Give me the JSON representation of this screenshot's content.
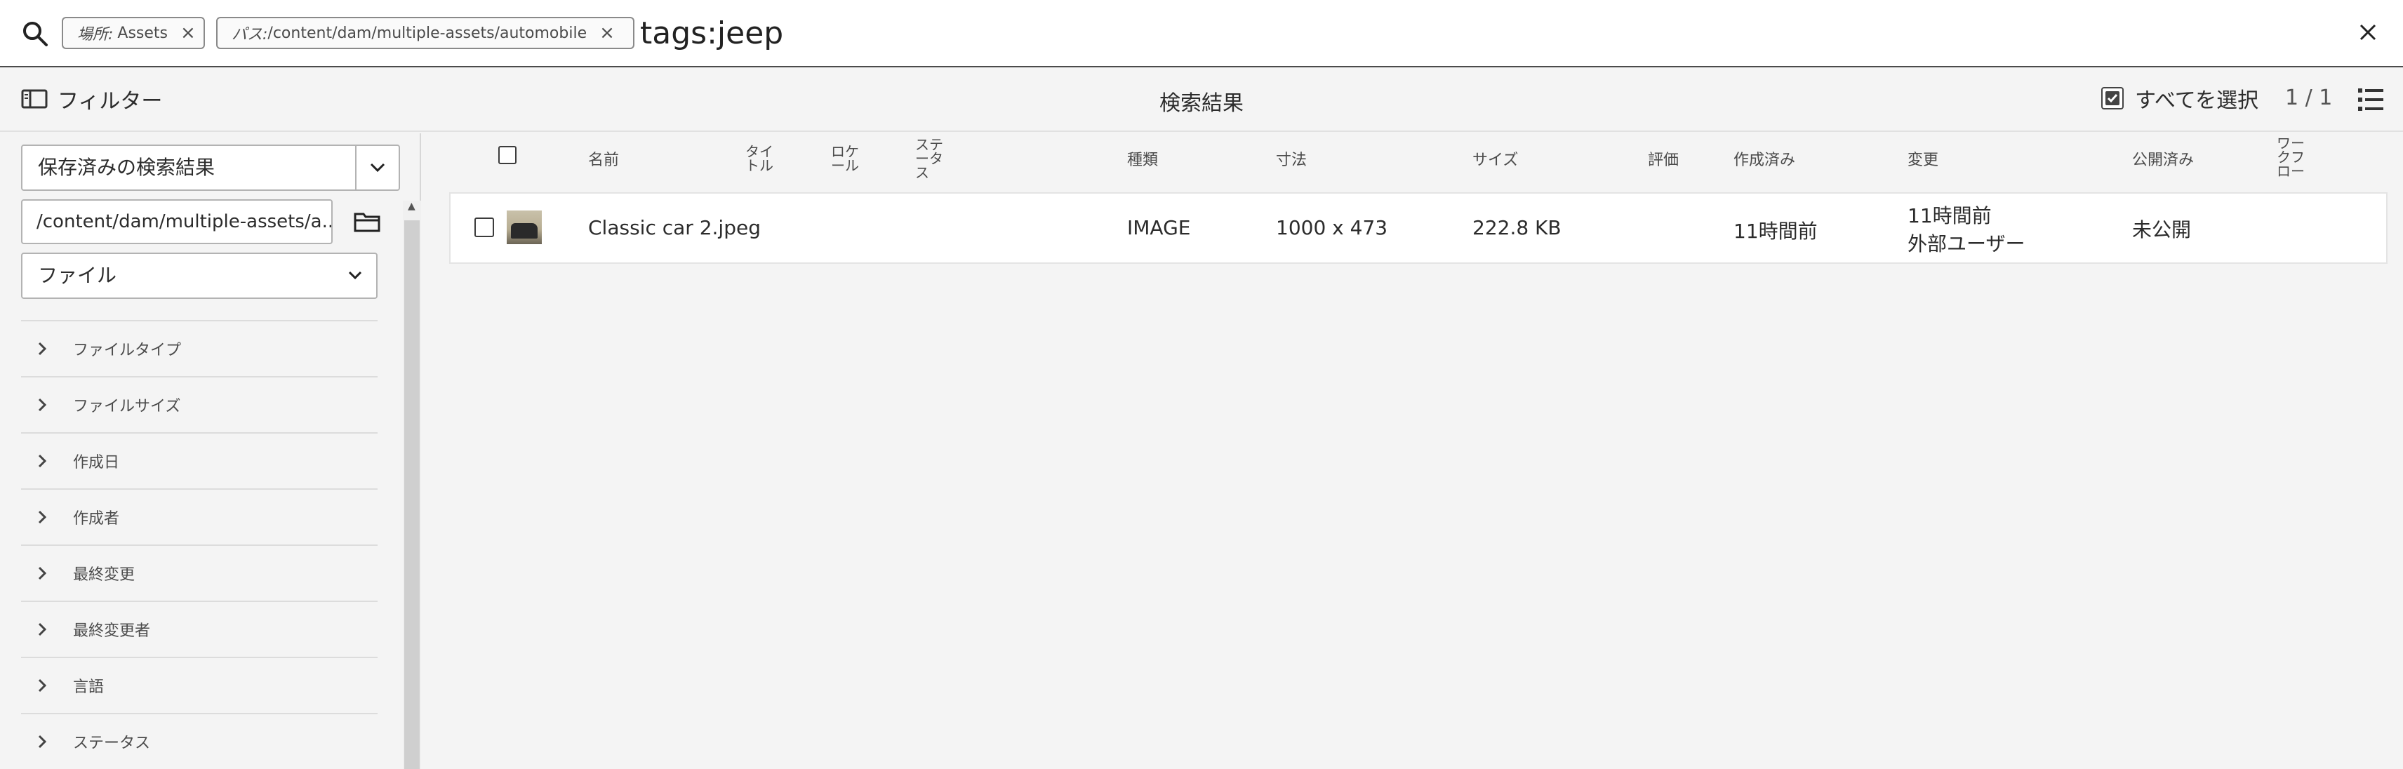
{
  "search": {
    "tags": [
      {
        "key": "場所:",
        "value": "Assets"
      },
      {
        "key": "パス:",
        "value": "/content/dam/multiple-assets/automobile"
      }
    ],
    "query": "tags:jeep"
  },
  "toolbar": {
    "filter_label": "フィルター",
    "results_title": "検索結果",
    "select_all_label": "すべてを選択",
    "pager": "1 / 1"
  },
  "rail": {
    "saved_searches": "保存済みの検索結果",
    "path_value": "/content/dam/multiple-assets/a...",
    "type_select": "ファイル",
    "facets": [
      "ファイルタイプ",
      "ファイルサイズ",
      "作成日",
      "作成者",
      "最終変更",
      "最終変更者",
      "言語",
      "ステータス"
    ]
  },
  "table": {
    "headers": {
      "name": "名前",
      "title": "タイ\nトル",
      "locale": "ロケ\nール",
      "status": "ステ\nータ\nス",
      "type": "種類",
      "dimensions": "寸法",
      "size": "サイズ",
      "rating": "評価",
      "created": "作成済み",
      "modified": "変更",
      "published": "公開済み",
      "workflow": "ワー\nクフ\nロー"
    },
    "rows": [
      {
        "name": "Classic car 2.jpeg",
        "type": "IMAGE",
        "dimensions": "1000 x 473",
        "size": "222.8 KB",
        "created": "11時間前",
        "modified_time": "11時間前",
        "modified_by": "外部ユーザー",
        "published": "未公開"
      }
    ]
  }
}
